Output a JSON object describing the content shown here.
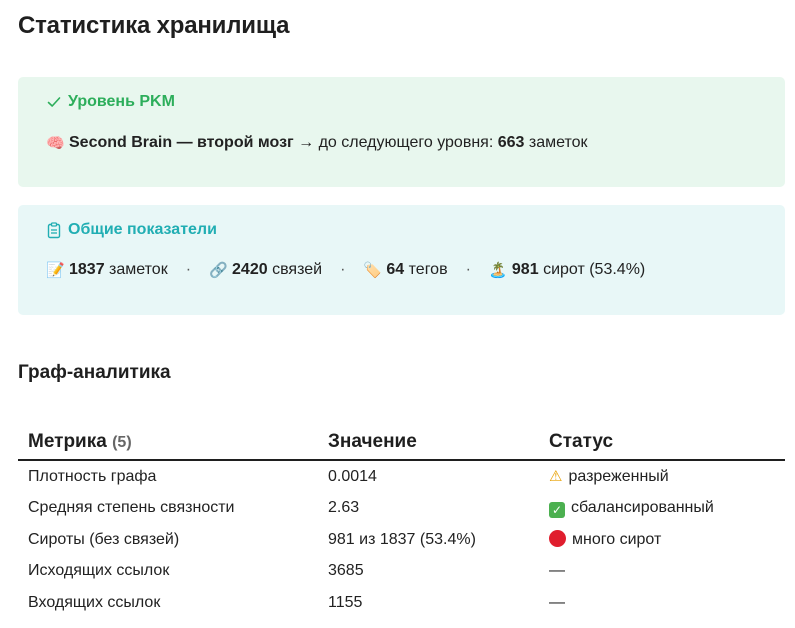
{
  "page": {
    "title": "Статистика хранилища"
  },
  "pkm_callout": {
    "title": "Уровень PKM",
    "icon": "checkmark-icon",
    "level_emoji": "🧠",
    "level_name": "Second Brain — второй мозг",
    "arrow": "→",
    "next_level_text": "до следующего уровня:",
    "notes_needed": "663",
    "notes_word": "заметок",
    "color": "#2dae5b"
  },
  "overview_callout": {
    "title": "Общие показатели",
    "icon": "clipboard-icon",
    "separator": "·",
    "color": "#21aeb3",
    "stats": [
      {
        "emoji": "📝",
        "value": "1837",
        "label": "заметок"
      },
      {
        "emoji": "🔗",
        "value": "2420",
        "label": "связей"
      },
      {
        "emoji": "🏷️",
        "value": "64",
        "label": "тегов"
      },
      {
        "emoji": "🏝️",
        "value": "981",
        "label": "сирот (53.4%)"
      }
    ]
  },
  "graph_section": {
    "title": "Граф-аналитика",
    "table": {
      "headers": {
        "metric": "Метрика",
        "metric_count": "(5)",
        "value": "Значение",
        "status": "Статус"
      },
      "rows": [
        {
          "metric": "Плотность графа",
          "value": "0.0014",
          "status_icon": "warning-icon",
          "status_glyph": "⚠",
          "status": "разреженный"
        },
        {
          "metric": "Средняя степень связности",
          "value": "2.63",
          "status_icon": "checkbox-icon",
          "status_glyph": "✓",
          "status": "сбалансированный"
        },
        {
          "metric": "Сироты (без связей)",
          "value": "981 из 1837 (53.4%)",
          "status_icon": "red-circle-icon",
          "status_glyph": "",
          "status": "много сирот"
        },
        {
          "metric": "Исходящих ссылок",
          "value": "3685",
          "status_icon": "",
          "status_glyph": "",
          "status": "—"
        },
        {
          "metric": "Входящих ссылок",
          "value": "1155",
          "status_icon": "",
          "status_glyph": "",
          "status": "—"
        }
      ]
    }
  }
}
